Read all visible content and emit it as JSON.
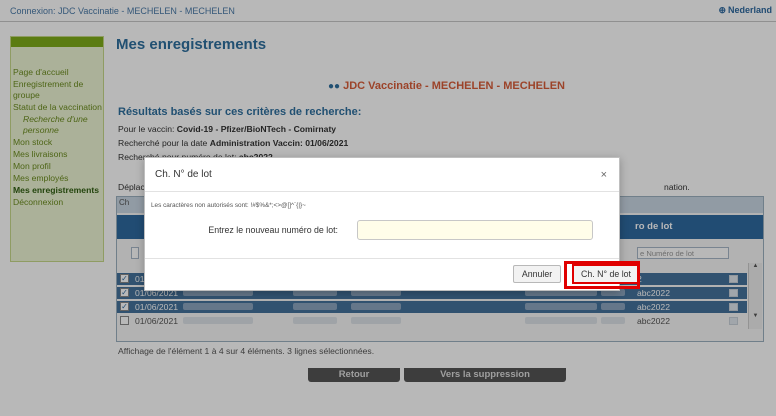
{
  "topbar": {
    "connection": "Connexion: JDC Vaccinatie - MECHELEN - MECHELEN",
    "language": "Nederland",
    "globe_icon": "globe-icon"
  },
  "sidebar": {
    "items": [
      {
        "label": "Page d'accueil"
      },
      {
        "label": "Enregistrement de groupe"
      },
      {
        "label": "Statut de la vaccination"
      },
      {
        "label": "Recherche d'une personne",
        "sub": true
      },
      {
        "label": "Mon stock"
      },
      {
        "label": "Mes livraisons"
      },
      {
        "label": "Mon profil"
      },
      {
        "label": "Mes employés"
      },
      {
        "label": "Mes enregistrements",
        "active": true
      },
      {
        "label": "Déconnexion"
      }
    ]
  },
  "main": {
    "title": "Mes enregistrements",
    "centre": "JDC Vaccinatie - MECHELEN - MECHELEN",
    "results_title": "Résultats basés sur ces critères de recherche:",
    "criteria": [
      {
        "prefix": "Pour le vaccin: ",
        "value": "Covid-19 - Pfizer/BioNTech - Comirnaty"
      },
      {
        "prefix": "Recherché pour la date ",
        "value": "Administration Vaccin: 01/06/2021"
      },
      {
        "prefix": "Recherché pour numéro de lot: ",
        "value": "abc2022"
      }
    ],
    "hint_left": "Déplac",
    "hint_right": "nation."
  },
  "table": {
    "tab_label": "Ch",
    "lot_header": "ro de lot",
    "filter_placeholder": "e Numéro de lot",
    "rows": [
      {
        "date": "01",
        "lot": "2",
        "selected": true
      },
      {
        "date": "01/06/2021",
        "lot": "abc2022",
        "selected": true
      },
      {
        "date": "01/06/2021",
        "lot": "abc2022",
        "selected": true
      },
      {
        "date": "01/06/2021",
        "lot": "abc2022",
        "selected": false
      }
    ],
    "footer": "Affichage de l'élément 1 à 4 sur 4 éléments.    3 lignes sélectionnées."
  },
  "actions": {
    "back": "Retour",
    "to_delete": "Vers la suppression"
  },
  "modal": {
    "title": "Ch. N° de lot",
    "close": "×",
    "note": "Les caractères non autorisés sont: !#$%&*;<>@[]^`{|}~",
    "label": "Entrez le nouveau numéro de lot:",
    "input_value": "",
    "cancel": "Annuler",
    "confirm": "Ch. N° de lot",
    "highlight_color": "#e00000"
  }
}
